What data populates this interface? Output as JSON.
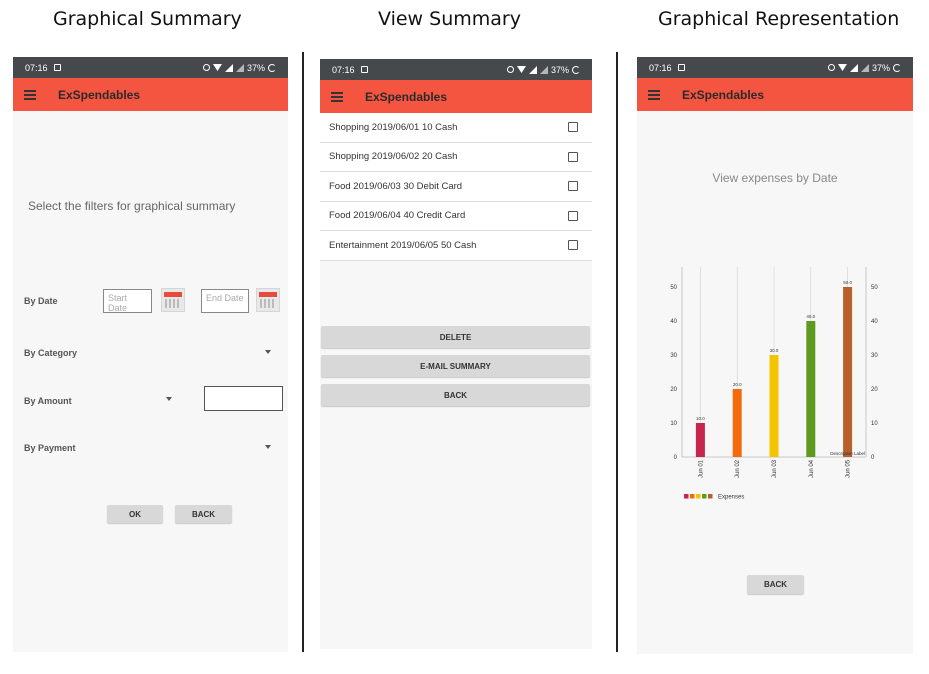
{
  "captions": [
    "Graphical Summary",
    "View Summary",
    "Graphical Representation"
  ],
  "status": {
    "time": "07:16",
    "battery": "37%"
  },
  "app_title": "ExSpendables",
  "screen1": {
    "prompt": "Select the filters for graphical summary",
    "by_date": "By Date",
    "start_date_placeholder": "Start Date",
    "end_date_placeholder": "End Date",
    "by_category": "By Category",
    "by_amount": "By Amount",
    "by_payment": "By Payment",
    "ok": "OK",
    "back": "BACK"
  },
  "screen2": {
    "items": [
      "Shopping 2019/06/01  10 Cash",
      "Shopping 2019/06/02  20 Cash",
      "Food 2019/06/03  30 Debit Card",
      "Food 2019/06/04  40 Credit Card",
      "Entertainment 2019/06/05  50 Cash"
    ],
    "delete": "DELETE",
    "email": "E-MAIL SUMMARY",
    "back": "BACK"
  },
  "screen3": {
    "title": "View expenses by Date",
    "back": "BACK"
  },
  "chart_data": {
    "type": "bar",
    "categories": [
      "Jun 01",
      "Jun 02",
      "Jun 03",
      "Jun 04",
      "Jun 05"
    ],
    "values": [
      10.0,
      20.0,
      30.0,
      40.0,
      50.0
    ],
    "value_labels": [
      "10.0",
      "20.0",
      "30.0",
      "40.0",
      "50.0"
    ],
    "colors": [
      "#c7254e",
      "#f26b0f",
      "#f5c400",
      "#5e9a1f",
      "#b8602c"
    ],
    "yticks": [
      "0",
      "10",
      "20",
      "30",
      "40",
      "50"
    ],
    "ylim": [
      0,
      50
    ],
    "legend": "Expenses",
    "description": "Description Label",
    "grid": true,
    "legend_position": "bottom-left"
  }
}
